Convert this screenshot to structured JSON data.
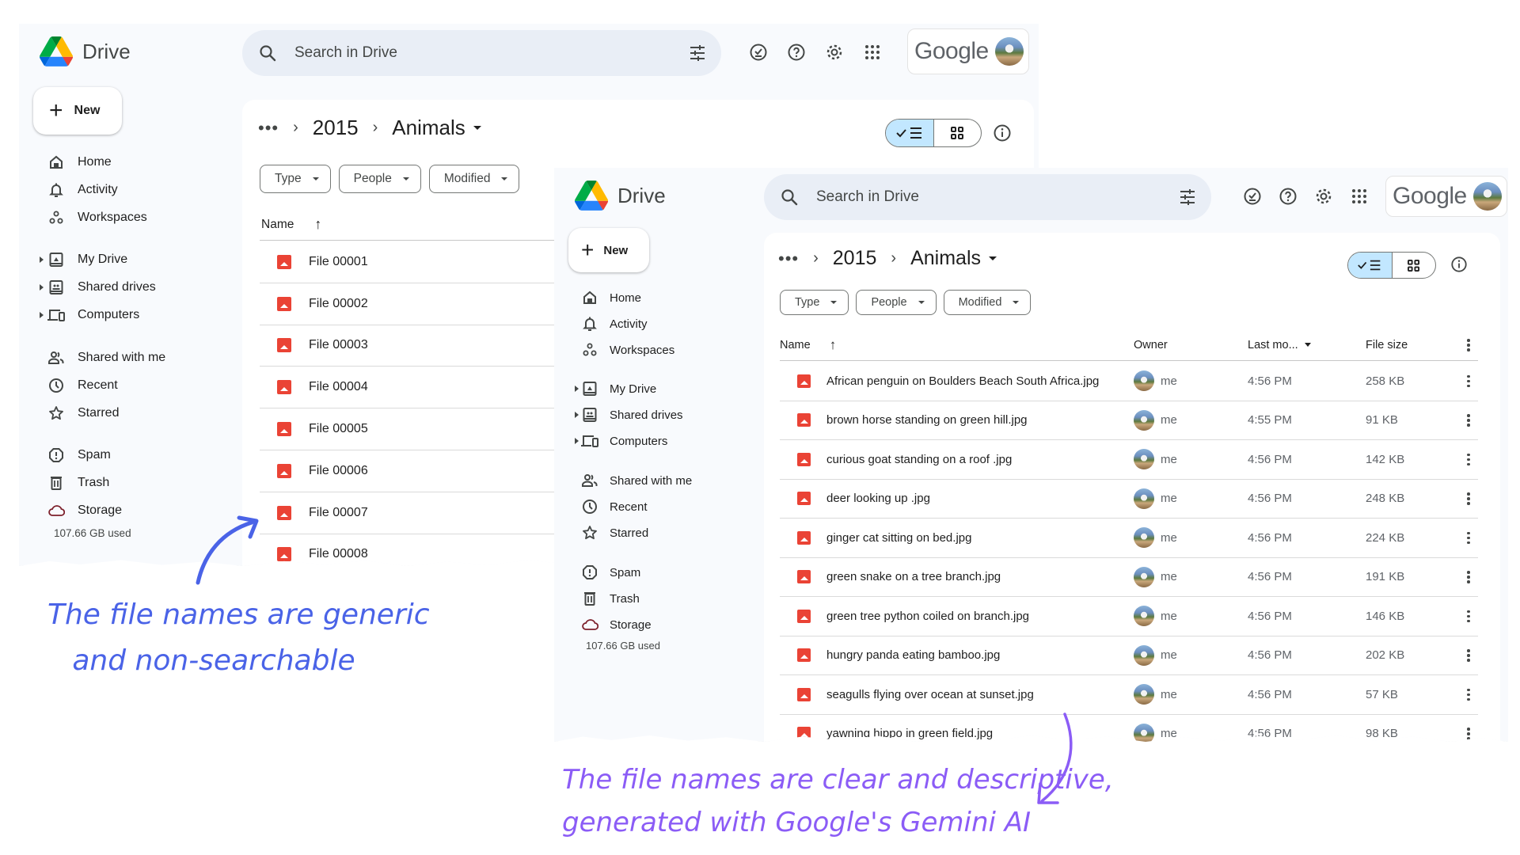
{
  "app": {
    "name": "Drive",
    "search_placeholder": "Search in Drive",
    "account_label": "Google",
    "new_label": "New"
  },
  "breadcrumb": {
    "overflow": "•••",
    "items": [
      "2015",
      "Animals"
    ]
  },
  "filters": [
    "Type",
    "People",
    "Modified"
  ],
  "sidebar": {
    "items": [
      {
        "label": "Home",
        "icon": "home-icon"
      },
      {
        "label": "Activity",
        "icon": "bell-icon"
      },
      {
        "label": "Workspaces",
        "icon": "workspaces-icon"
      },
      {
        "label": "My Drive",
        "icon": "my-drive-icon",
        "expandable": true
      },
      {
        "label": "Shared drives",
        "icon": "shared-drives-icon",
        "expandable": true
      },
      {
        "label": "Computers",
        "icon": "computers-icon",
        "expandable": true
      },
      {
        "label": "Shared with me",
        "icon": "people-icon"
      },
      {
        "label": "Recent",
        "icon": "clock-icon"
      },
      {
        "label": "Starred",
        "icon": "star-icon"
      },
      {
        "label": "Spam",
        "icon": "spam-icon"
      },
      {
        "label": "Trash",
        "icon": "trash-icon"
      },
      {
        "label": "Storage",
        "icon": "cloud-icon"
      }
    ],
    "storage_used": "107.66 GB used"
  },
  "before_window": {
    "columns": {
      "name": "Name"
    },
    "files": [
      "File 00001",
      "File 00002",
      "File 00003",
      "File 00004",
      "File 00005",
      "File 00006",
      "File 00007",
      "File 00008"
    ]
  },
  "after_window": {
    "columns": {
      "name": "Name",
      "owner": "Owner",
      "modified": "Last mo...",
      "size": "File size"
    },
    "files": [
      {
        "name": "African penguin on Boulders Beach South Africa.jpg",
        "owner": "me",
        "modified": "4:56 PM",
        "size": "258 KB"
      },
      {
        "name": "brown horse standing on green hill.jpg",
        "owner": "me",
        "modified": "4:55 PM",
        "size": "91 KB"
      },
      {
        "name": "curious goat standing on a roof .jpg",
        "owner": "me",
        "modified": "4:56 PM",
        "size": "142 KB"
      },
      {
        "name": "deer looking up .jpg",
        "owner": "me",
        "modified": "4:56 PM",
        "size": "248 KB"
      },
      {
        "name": "ginger cat sitting on bed.jpg",
        "owner": "me",
        "modified": "4:56 PM",
        "size": "224 KB"
      },
      {
        "name": "green snake on a tree branch.jpg",
        "owner": "me",
        "modified": "4:56 PM",
        "size": "191 KB"
      },
      {
        "name": "green tree python coiled on branch.jpg",
        "owner": "me",
        "modified": "4:56 PM",
        "size": "146 KB"
      },
      {
        "name": "hungry panda eating bamboo.jpg",
        "owner": "me",
        "modified": "4:56 PM",
        "size": "202 KB"
      },
      {
        "name": "seagulls flying over ocean at sunset.jpg",
        "owner": "me",
        "modified": "4:56 PM",
        "size": "57 KB"
      },
      {
        "name": "yawning hippo in green field.jpg",
        "owner": "me",
        "modified": "4:56 PM",
        "size": "98 KB"
      }
    ]
  },
  "annotations": {
    "generic": [
      "The file names are generic",
      "and  non-searchable"
    ],
    "descriptive": [
      "The file names are clear and descriptive,",
      "generated with Google's Gemini AI"
    ]
  },
  "colors": {
    "annotation_blue": "#4a63e7",
    "annotation_purple": "#8b5cf6",
    "file_icon_red": "#ea4335",
    "view_toggle_active": "#c2e7ff",
    "sidebar_bg": "#f8fafd"
  }
}
